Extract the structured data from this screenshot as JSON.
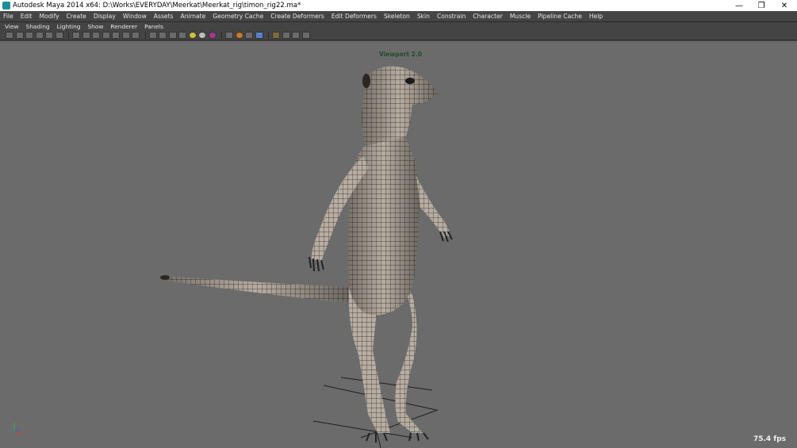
{
  "window": {
    "title": "Autodesk Maya 2014 x64: D:\\Works\\EVERYDAY\\Meerkat\\Meerkat_rig\\timon_rig22.ma*",
    "minimize_icon": "minimize-icon",
    "restore_icon": "restore-icon",
    "close_icon": "close-icon"
  },
  "menubar": {
    "items": [
      "File",
      "Edit",
      "Modify",
      "Create",
      "Display",
      "Window",
      "Assets",
      "Animate",
      "Geometry Cache",
      "Create Deformers",
      "Edit Deformers",
      "Skeleton",
      "Skin",
      "Constrain",
      "Character",
      "Muscle",
      "Pipeline Cache",
      "Help"
    ]
  },
  "panel_menu": {
    "items": [
      "View",
      "Shading",
      "Lighting",
      "Show",
      "Renderer",
      "Panels"
    ]
  },
  "viewport": {
    "label": "Viewport 2.0",
    "fps": "75.4 fps",
    "background_color": "#6b6b6b"
  }
}
